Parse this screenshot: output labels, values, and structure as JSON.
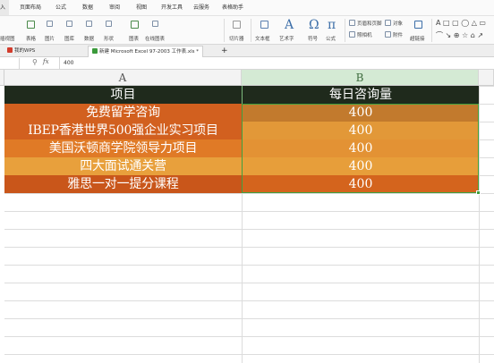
{
  "menu": {
    "items": [
      "入",
      "页面布局",
      "公式",
      "数据",
      "审阅",
      "视图",
      "开发工具",
      "云服务",
      "表格助手"
    ]
  },
  "ribbon": {
    "left_cut_label": "插视图",
    "labels": [
      "表格",
      "图片",
      "图库",
      "数据",
      "形状",
      "图表",
      "在线图表",
      "切片器",
      "文本框",
      "艺术字",
      "符号",
      "公式",
      "页眉和页脚",
      "对象",
      "照相机",
      "附件",
      "超链接"
    ]
  },
  "tabs": {
    "wps": "我的WPS",
    "doc": "新建 Microsoft Excel 97-2003 工作表.xls *",
    "add": "+"
  },
  "formula": {
    "fx": "fx",
    "value": "400"
  },
  "columns": {
    "a": "A",
    "b": "B"
  },
  "table": {
    "header_item": "项目",
    "header_count": "每日咨询量",
    "rows": [
      {
        "item": "免费留学咨询",
        "count": "400"
      },
      {
        "item": "IBEP香港世界500强企业实习项目",
        "count": "400"
      },
      {
        "item": "美国沃顿商学院领导力项目",
        "count": "400"
      },
      {
        "item": "四大面试通关营",
        "count": "400"
      },
      {
        "item": "雅思一对一提分课程",
        "count": "400"
      }
    ]
  },
  "colors": {
    "header_bg": "#1f2a1c",
    "row_colors_a": [
      "#d2601f",
      "#d2601f",
      "#e07a26",
      "#e8a03c",
      "#c9561a"
    ],
    "row_colors_b": [
      "#c27a2d",
      "#e29838",
      "#e39234",
      "#e79e3a",
      "#d4641d"
    ],
    "selection": "#3fa03f"
  }
}
